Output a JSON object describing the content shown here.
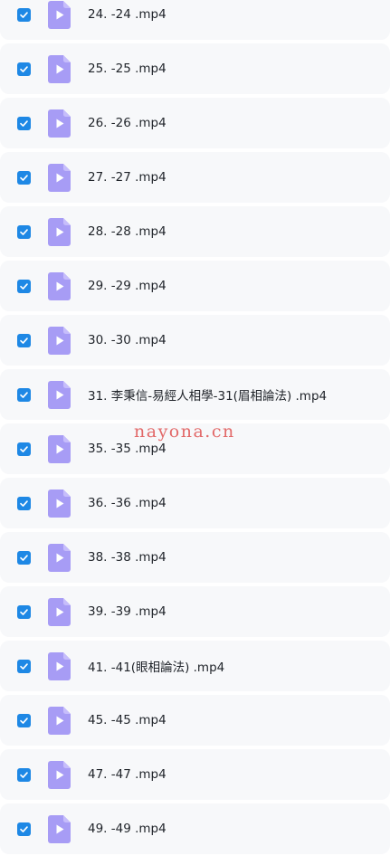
{
  "files": [
    {
      "name": "24. -24 .mp4",
      "checked": true
    },
    {
      "name": "25. -25 .mp4",
      "checked": true
    },
    {
      "name": "26. -26 .mp4",
      "checked": true
    },
    {
      "name": "27. -27 .mp4",
      "checked": true
    },
    {
      "name": "28. -28 .mp4",
      "checked": true
    },
    {
      "name": "29. -29 .mp4",
      "checked": true
    },
    {
      "name": "30. -30 .mp4",
      "checked": true
    },
    {
      "name": "31. 李秉信-易經人相學-31(眉相論法) .mp4",
      "checked": true
    },
    {
      "name": "35. -35 .mp4",
      "checked": true
    },
    {
      "name": "36. -36 .mp4",
      "checked": true
    },
    {
      "name": "38. -38 .mp4",
      "checked": true
    },
    {
      "name": "39. -39 .mp4",
      "checked": true
    },
    {
      "name": "41. -41(眼相論法) .mp4",
      "checked": true
    },
    {
      "name": "45. -45 .mp4",
      "checked": true
    },
    {
      "name": "47. -47 .mp4",
      "checked": true
    },
    {
      "name": "49. -49 .mp4",
      "checked": true
    }
  ],
  "watermark": "nayona.cn",
  "colors": {
    "checkbox": "#1e88e5",
    "file_icon": "#a79cf5",
    "row_background": "#f7f8fa",
    "watermark": "#e05a5a"
  },
  "icons": {
    "checkbox": "checkmark-icon",
    "file": "video-file-icon"
  }
}
